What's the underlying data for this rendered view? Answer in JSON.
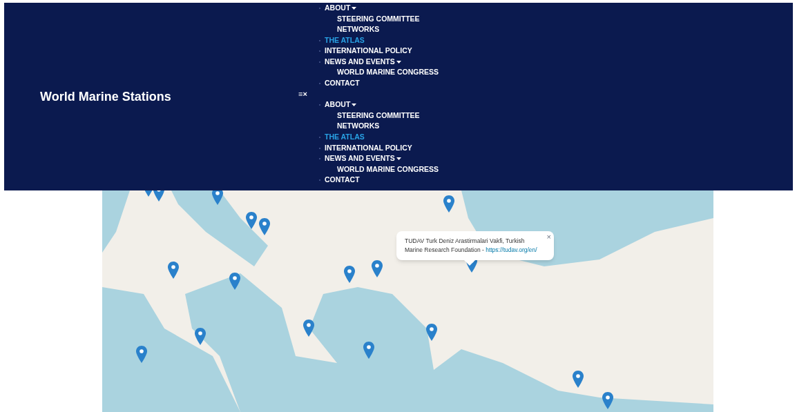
{
  "site_title": "World Marine Stations",
  "menus": [
    {
      "items": [
        {
          "label": "ABOUT",
          "selected": false,
          "children": [
            {
              "label": "STEERING COMMITTEE"
            },
            {
              "label": "NETWORKS"
            }
          ]
        },
        {
          "label": "THE ATLAS",
          "selected": true
        },
        {
          "label": "INTERNATIONAL POLICY",
          "selected": false
        },
        {
          "label": "NEWS AND EVENTS",
          "selected": false,
          "children": [
            {
              "label": "WORLD MARINE CONGRESS"
            }
          ]
        },
        {
          "label": "CONTACT",
          "selected": false
        }
      ]
    },
    {
      "items": [
        {
          "label": "ABOUT",
          "selected": false,
          "children": [
            {
              "label": "STEERING COMMITTEE"
            },
            {
              "label": "NETWORKS"
            }
          ]
        },
        {
          "label": "THE ATLAS",
          "selected": true
        },
        {
          "label": "INTERNATIONAL POLICY",
          "selected": false
        },
        {
          "label": "NEWS AND EVENTS",
          "selected": false,
          "children": [
            {
              "label": "WORLD MARINE CONGRESS"
            }
          ]
        },
        {
          "label": "CONTACT",
          "selected": false
        }
      ]
    }
  ],
  "menu_toggle": "≡×",
  "popup": {
    "text": "TUDAV Turk Deniz Arastirmalari Vakfi, Turkish Marine Research Foundation - ",
    "link": "https://tudav.org/en/",
    "close": "×"
  }
}
